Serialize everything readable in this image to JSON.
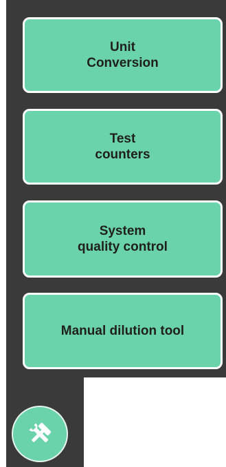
{
  "menu": {
    "items": [
      {
        "label": "Unit\nConversion"
      },
      {
        "label": "Test\ncounters"
      },
      {
        "label": "System\nquality control"
      },
      {
        "label": "Manual dilution tool"
      }
    ]
  },
  "tools": {
    "icon": "tools-icon"
  },
  "colors": {
    "panel": "#3a3a3a",
    "button": "#6bd3ac",
    "border": "#ffffff",
    "text": "#1f1f1f"
  }
}
